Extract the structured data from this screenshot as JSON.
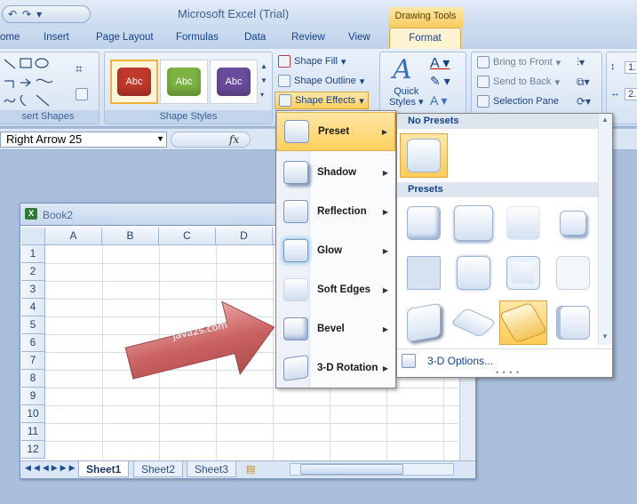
{
  "app": {
    "title": "Microsoft Excel (Trial)",
    "context_tab_group": "Drawing Tools"
  },
  "tabs": [
    "ome",
    "Insert",
    "Page Layout",
    "Formulas",
    "Data",
    "Review",
    "View"
  ],
  "active_tab": "Format",
  "ribbon": {
    "groups": {
      "insert_shapes": "sert Shapes",
      "shape_styles": "Shape Styles"
    },
    "style_thumbs": [
      {
        "label": "Abc",
        "color": "#c0392b"
      },
      {
        "label": "Abc",
        "color": "#7cb342"
      },
      {
        "label": "Abc",
        "color": "#6a4c9c"
      }
    ],
    "shape_fill": "Shape Fill",
    "shape_outline": "Shape Outline",
    "shape_effects": "Shape Effects",
    "quick_styles_1": "Quick",
    "quick_styles_2": "Styles",
    "bring_to_front": "Bring to Front",
    "send_to_back": "Send to Back",
    "selection_pane": "Selection Pane",
    "size_1": "1.",
    "size_2": "2."
  },
  "formula_bar": {
    "name_box": "Right Arrow 25",
    "fx": "fx"
  },
  "workbook": {
    "title": "Book2",
    "columns": [
      "A",
      "B",
      "C",
      "D"
    ],
    "rows": [
      "1",
      "2",
      "3",
      "4",
      "5",
      "6",
      "7",
      "8",
      "9",
      "10",
      "11",
      "12"
    ],
    "sheets": [
      "Sheet1",
      "Sheet2",
      "Sheet3"
    ],
    "active_sheet": "Sheet1",
    "shape_text": "java2s.com"
  },
  "effects_menu": {
    "items": [
      {
        "label": "Preset",
        "highlighted": true
      },
      {
        "label": "Shadow"
      },
      {
        "label": "Reflection"
      },
      {
        "label": "Glow"
      },
      {
        "label": "Soft Edges"
      },
      {
        "label": "Bevel"
      },
      {
        "label": "3-D Rotation"
      }
    ]
  },
  "gallery": {
    "no_presets": "No Presets",
    "presets": "Presets",
    "options": "3-D Options...",
    "preset_count": 12,
    "selected_preset_index": 10
  },
  "colors": {
    "highlight": "#ffcf5c",
    "ribbon": "#cfdef2",
    "arrow": "#c95a5a"
  }
}
